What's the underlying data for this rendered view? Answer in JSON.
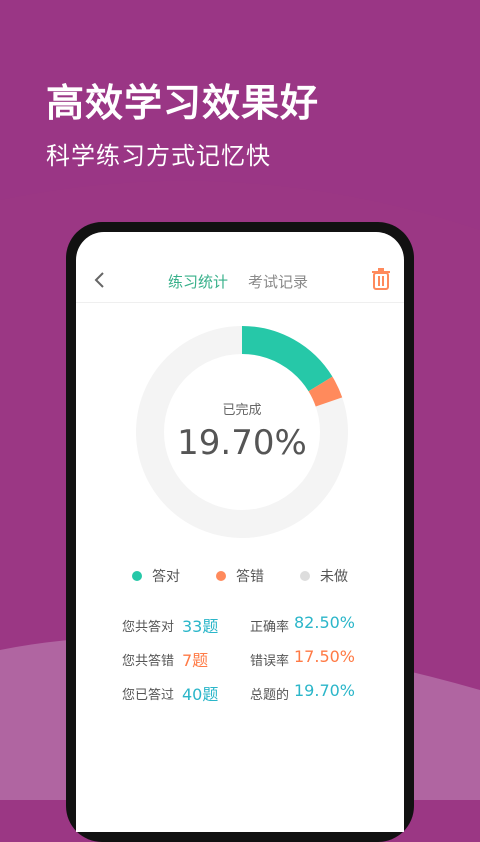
{
  "headline": "高效学习效果好",
  "subline": "科学练习方式记忆快",
  "colors": {
    "background": "#9b3784",
    "correct": "#26c8a8",
    "wrong": "#ff8a5c",
    "undone": "#dddddd",
    "tab_active": "#37b08a",
    "blue_value": "#2bb6c9",
    "orange_value": "#ff7a45"
  },
  "header": {
    "back_icon": "chevron-left-icon",
    "tabs": [
      {
        "label": "练习统计",
        "active": true
      },
      {
        "label": "考试记录",
        "active": false
      }
    ],
    "trash_icon": "trash-icon"
  },
  "donut": {
    "label": "已完成",
    "value_text": "19.70%",
    "correct_fraction": 0.1625,
    "wrong_fraction": 0.0345
  },
  "legend": [
    {
      "label": "答对"
    },
    {
      "label": "答错"
    },
    {
      "label": "未做"
    }
  ],
  "stats": {
    "answered_correct_label": "您共答对",
    "answered_correct_value": "33题",
    "answered_wrong_label": "您共答错",
    "answered_wrong_value": "7题",
    "answered_total_label": "您已答过",
    "answered_total_value": "40题",
    "accuracy_label": "正确率",
    "accuracy_value": "82.50%",
    "error_rate_label": "错误率",
    "error_rate_value": "17.50%",
    "total_ratio_label": "总题的",
    "total_ratio_value": "19.70%"
  }
}
